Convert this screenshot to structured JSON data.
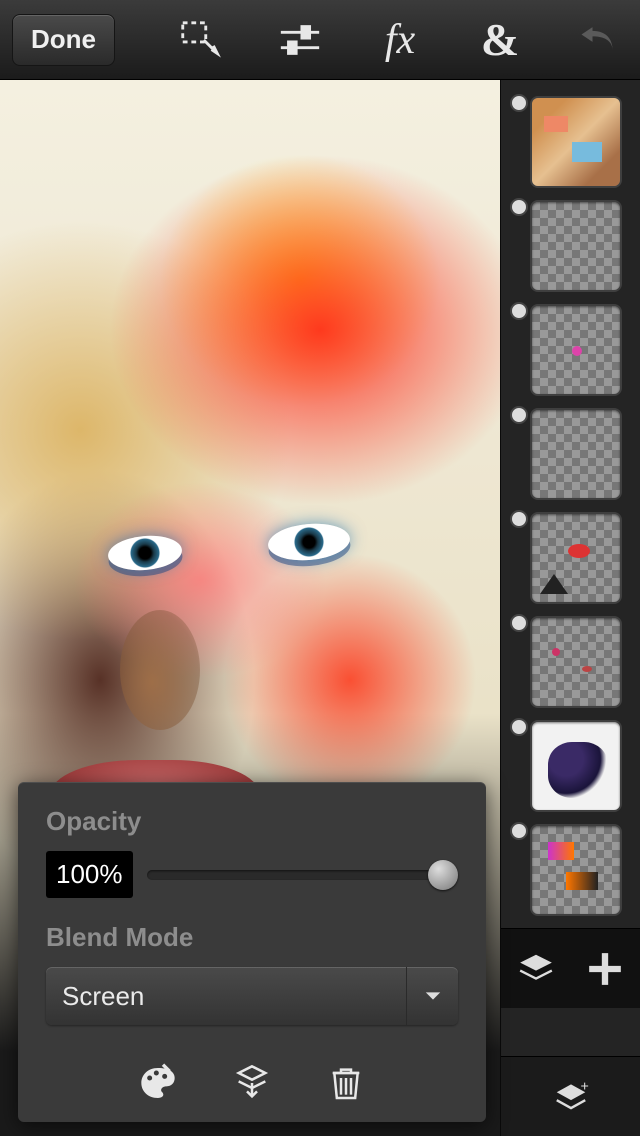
{
  "toolbar": {
    "done_label": "Done",
    "fx_label": "fx",
    "combine_label": "&"
  },
  "layers": {
    "items": [
      {
        "visible": true,
        "kind": "collage"
      },
      {
        "visible": true,
        "kind": "empty"
      },
      {
        "visible": true,
        "kind": "pink-dot"
      },
      {
        "visible": true,
        "kind": "empty"
      },
      {
        "visible": true,
        "kind": "paint-triangle"
      },
      {
        "visible": true,
        "kind": "specks"
      },
      {
        "visible": true,
        "kind": "ink"
      },
      {
        "visible": true,
        "kind": "swatches"
      }
    ]
  },
  "properties": {
    "opacity_label": "Opacity",
    "opacity_value": "100%",
    "opacity_percent": 100,
    "blend_label": "Blend Mode",
    "blend_value": "Screen"
  }
}
